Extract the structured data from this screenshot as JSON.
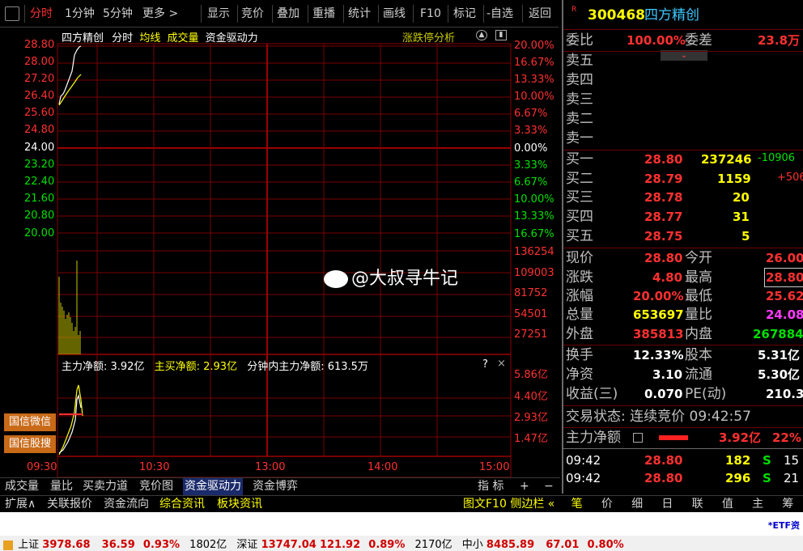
{
  "toolbar": {
    "items": [
      "分时",
      "1分钟",
      "5分钟",
      "更多 >",
      "显示",
      "竞价",
      "叠加",
      "重播",
      "统计",
      "画线",
      "F10",
      "标记",
      "-自选",
      "返回"
    ]
  },
  "chart": {
    "header": {
      "name": "四方精创",
      "mode": "分时",
      "avg": "均线",
      "vol": "成交量",
      "fund": "资金驱动力",
      "limit": "涨跌停分析"
    },
    "price_ticks": [
      "28.80",
      "28.00",
      "27.20",
      "26.40",
      "25.60",
      "24.80",
      "24.00",
      "23.20",
      "22.40",
      "21.60",
      "20.80",
      "20.00"
    ],
    "pct_ticks": [
      "20.00%",
      "16.67%",
      "13.33%",
      "10.00%",
      "6.67%",
      "3.33%",
      "0.00%",
      "3.33%",
      "6.67%",
      "10.00%",
      "13.33%",
      "16.67%"
    ],
    "vol_ticks": [
      "136254",
      "109003",
      "81752",
      "54501",
      "27251"
    ],
    "fund_header": {
      "main": "主力净额: 3.92亿",
      "big": "主买净额: 2.93亿",
      "minute": "分钟内主力净额: 613.5万"
    },
    "fund_ticks": [
      "5.86亿",
      "4.40亿",
      "2.93亿",
      "1.47亿"
    ],
    "times": [
      "09:30",
      "10:30",
      "13:00",
      "14:00",
      "15:00"
    ],
    "watermark": "@大叔寻牛记",
    "side_buttons": [
      "国信微信",
      "国信股搜"
    ]
  },
  "tabs": [
    "成交量",
    "量比",
    "买卖力道",
    "竞价图",
    "资金驱动力",
    "资金博弈"
  ],
  "tabs_right": [
    "指 标",
    "+",
    "−"
  ],
  "tabs2": [
    "扩展∧",
    "关联报价",
    "资金流向",
    "综合资讯",
    "板块资讯"
  ],
  "tabs2_right": "图文F10 侧边栏 «",
  "right": {
    "code": "300468",
    "name": "四方精创",
    "badge": "R",
    "wb": {
      "label": "委比",
      "val": "100.00%",
      "label2": "委差",
      "val2": "23.8万"
    },
    "sell": [
      "卖五",
      "卖四",
      "卖三",
      "卖二",
      "卖一"
    ],
    "buy": [
      {
        "l": "买一",
        "p": "28.80",
        "v": "237246",
        "c": "-10906"
      },
      {
        "l": "买二",
        "p": "28.79",
        "v": "1159",
        "c": "+506"
      },
      {
        "l": "买三",
        "p": "28.78",
        "v": "20",
        "c": ""
      },
      {
        "l": "买四",
        "p": "28.77",
        "v": "31",
        "c": ""
      },
      {
        "l": "买五",
        "p": "28.75",
        "v": "5",
        "c": ""
      }
    ],
    "q": [
      {
        "l": "现价",
        "v": "28.80",
        "l2": "今开",
        "v2": "26.00"
      },
      {
        "l": "涨跌",
        "v": "4.80",
        "l2": "最高",
        "v2": "28.80"
      },
      {
        "l": "涨幅",
        "v": "20.00%",
        "l2": "最低",
        "v2": "25.62"
      },
      {
        "l": "总量",
        "v": "653697",
        "l2": "量比",
        "v2": "24.08"
      },
      {
        "l": "外盘",
        "v": "385813",
        "l2": "内盘",
        "v2": "267884"
      }
    ],
    "f": [
      {
        "l": "换手",
        "v": "12.33%",
        "l2": "股本",
        "v2": "5.31亿"
      },
      {
        "l": "净资",
        "v": "3.10",
        "l2": "流通",
        "v2": "5.30亿"
      },
      {
        "l": "收益(三)",
        "v": "0.070",
        "l2": "PE(动)",
        "v2": "210.3"
      }
    ],
    "state": "交易状态: 连续竞价 09:42:57",
    "main_net": {
      "l": "主力净额",
      "v": "3.92亿",
      "p": "22%"
    },
    "ticks": [
      {
        "t": "09:42",
        "p": "28.80",
        "v": "182",
        "s": "S",
        "n": "15"
      },
      {
        "t": "09:42",
        "p": "28.80",
        "v": "296",
        "s": "S",
        "n": "21"
      }
    ],
    "bottom_tabs": [
      "笔",
      "价",
      "细",
      "日",
      "联",
      "值",
      "主",
      "筹"
    ]
  },
  "etf": "*ETF资",
  "status": {
    "sh": {
      "name": "上证",
      "val": "3978.68",
      "chg": "36.59",
      "pct": "0.93%",
      "amt": "1802亿"
    },
    "sz": {
      "name": "深证",
      "val": "13747.04",
      "chg": "121.92",
      "pct": "0.89%",
      "amt": "2170亿"
    },
    "zx": {
      "name": "中小",
      "val": "8485.89",
      "chg": "67.01",
      "pct": "0.80%"
    }
  }
}
